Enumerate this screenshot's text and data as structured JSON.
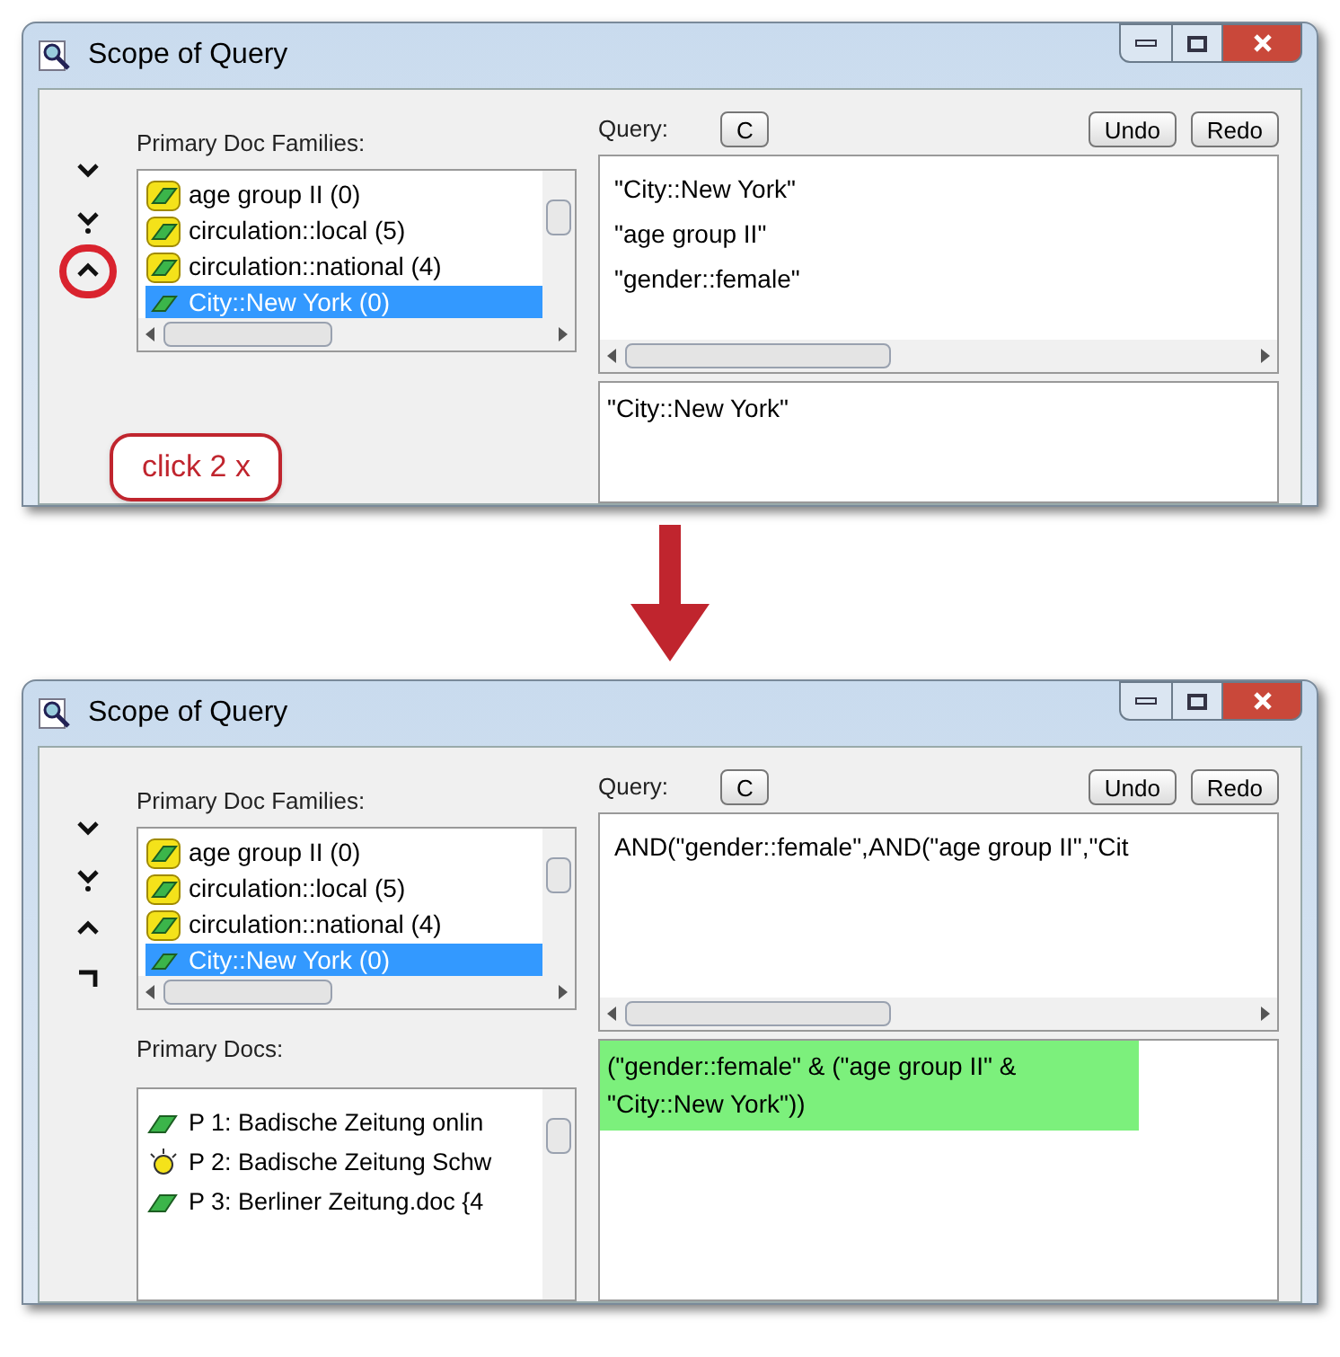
{
  "panels": [
    {
      "title": "Scope of Query",
      "arrows": [
        {
          "kind": "down",
          "highlighted": false
        },
        {
          "kind": "down_dot",
          "highlighted": false
        },
        {
          "kind": "up",
          "highlighted": true
        }
      ],
      "families": {
        "label": "Primary Doc Families:",
        "items": [
          {
            "text": "age group II (0)",
            "selected": false
          },
          {
            "text": "circulation::local (5)",
            "selected": false
          },
          {
            "text": "circulation::national (4)",
            "selected": false
          },
          {
            "text": "City::New York (0)",
            "selected": true
          }
        ]
      },
      "query": {
        "label": "Query:",
        "buttons": [
          "C",
          "Undo",
          "Redo"
        ],
        "lines": [
          "\"City::New York\"",
          "\"age group II\"",
          "\"gender::female\""
        ],
        "result": "\"City::New York\"",
        "result_valid": false
      },
      "callout": "click 2 x"
    },
    {
      "title": "Scope of Query",
      "arrows": [
        {
          "kind": "down",
          "highlighted": false
        },
        {
          "kind": "down_dot",
          "highlighted": false
        },
        {
          "kind": "up",
          "highlighted": false
        },
        {
          "kind": "corner",
          "highlighted": false
        }
      ],
      "families": {
        "label": "Primary Doc Families:",
        "items": [
          {
            "text": "age group II (0)",
            "selected": false
          },
          {
            "text": "circulation::local (5)",
            "selected": false
          },
          {
            "text": "circulation::national (4)",
            "selected": false
          },
          {
            "text": "City::New York (0)",
            "selected": true
          }
        ]
      },
      "docs": {
        "label": "Primary Docs:",
        "items": [
          {
            "text": "P 1: Badische Zeitung onlin",
            "kind": "doc"
          },
          {
            "text": "P 2: Badische Zeitung Schw",
            "kind": "bulb"
          },
          {
            "text": "P 3: Berliner Zeitung.doc {4",
            "kind": "doc"
          }
        ]
      },
      "query": {
        "label": "Query:",
        "buttons": [
          "C",
          "Undo",
          "Redo"
        ],
        "lines": [
          "AND(\"gender::female\",AND(\"age group II\",\"Cit"
        ],
        "result": "(\"gender::female\" & (\"age group II\" & \"City::New York\"))",
        "result_valid": true
      }
    }
  ]
}
